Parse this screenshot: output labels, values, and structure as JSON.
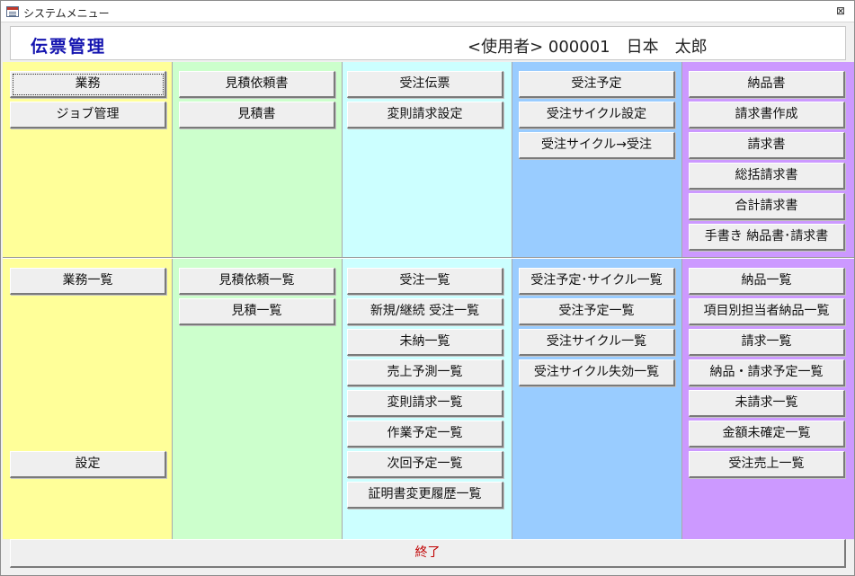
{
  "window": {
    "title": "システムメニュー",
    "close_symbol": "⊠"
  },
  "header": {
    "app_title": "伝票管理",
    "user_label": "<使用者> 000001　日本　太郎"
  },
  "top": {
    "col1": [
      "業務",
      "ジョブ管理"
    ],
    "col2": [
      "見積依頼書",
      "見積書"
    ],
    "col3": [
      "受注伝票",
      "変則請求設定"
    ],
    "col4": [
      "受注予定",
      "受注サイクル設定",
      "受注サイクル→受注"
    ],
    "col5": [
      "納品書",
      "請求書作成",
      "請求書",
      "総括請求書",
      "合計請求書",
      "手書き 納品書･請求書"
    ]
  },
  "bottom": {
    "col1": [
      "業務一覧",
      "設定"
    ],
    "col2": [
      "見積依頼一覧",
      "見積一覧"
    ],
    "col3": [
      "受注一覧",
      "新規/継続 受注一覧",
      "未納一覧",
      "売上予測一覧",
      "変則請求一覧",
      "作業予定一覧",
      "次回予定一覧",
      "証明書変更履歴一覧"
    ],
    "col4": [
      "受注予定･サイクル一覧",
      "受注予定一覧",
      "受注サイクル一覧",
      "受注サイクル失効一覧"
    ],
    "col5": [
      "納品一覧",
      "項目別担当者納品一覧",
      "請求一覧",
      "納品・請求予定一覧",
      "未請求一覧",
      "金額未確定一覧",
      "受注売上一覧"
    ]
  },
  "footer": {
    "exit_label": "終了"
  },
  "colors": {
    "col1": "#ffff99",
    "col2": "#ccffcc",
    "col3": "#ccffff",
    "col4": "#99ccff",
    "col5": "#cc99ff",
    "title_text": "#1515b0",
    "exit_text": "#c00000"
  }
}
